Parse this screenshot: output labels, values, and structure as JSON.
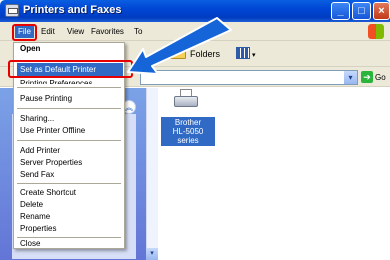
{
  "window": {
    "title": "Printers and Faxes"
  },
  "menubar": {
    "file": "File",
    "edit": "Edit",
    "view": "View",
    "favorites": "Favorites",
    "tools": "To"
  },
  "toolbar": {
    "folders": "Folders"
  },
  "addressbar": {
    "go": "Go"
  },
  "file_menu": {
    "items": [
      {
        "label": "Open"
      },
      {
        "label": "Set as Default Printer"
      },
      {
        "label": "Printing Preferences..."
      },
      {
        "label": "Pause Printing"
      },
      {
        "label": "Sharing..."
      },
      {
        "label": "Use Printer Offline"
      },
      {
        "label": "Add Printer"
      },
      {
        "label": "Server Properties"
      },
      {
        "label": "Send Fax"
      },
      {
        "label": "Create Shortcut"
      },
      {
        "label": "Delete"
      },
      {
        "label": "Rename"
      },
      {
        "label": "Properties"
      },
      {
        "label": "Close"
      }
    ]
  },
  "printer": {
    "label_line1": "Brother",
    "label_line2": "HL-5050 series"
  },
  "colors": {
    "highlight": "#316ac5",
    "callout": "#e60000",
    "arrow": "#1565d8"
  },
  "icons": [
    "printer-fax-icon",
    "windows-flag-icon",
    "folder-icon",
    "views-icon",
    "go-arrow-icon",
    "printer-icon",
    "collapse-chevron-icon"
  ]
}
